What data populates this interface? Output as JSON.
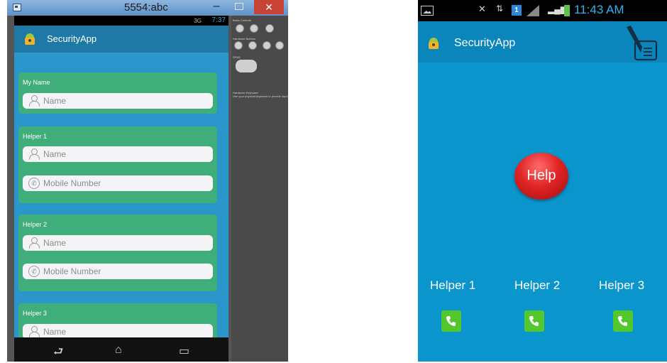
{
  "emulator": {
    "window_title": "5554:abc",
    "close_glyph": "✕",
    "minimize_glyph": "–",
    "status": {
      "signal": "3G",
      "time": "7:37"
    },
    "app_name": "SecurityApp",
    "form": [
      {
        "label": "My Name",
        "fields": [
          {
            "icon": "person-icon",
            "placeholder": "Name"
          }
        ]
      },
      {
        "label": "Helper 1",
        "fields": [
          {
            "icon": "person-icon",
            "placeholder": "Name"
          },
          {
            "icon": "phone-icon",
            "placeholder": "Mobile Number"
          }
        ]
      },
      {
        "label": "Helper 2",
        "fields": [
          {
            "icon": "person-icon",
            "placeholder": "Name"
          },
          {
            "icon": "phone-icon",
            "placeholder": "Mobile Number"
          }
        ]
      },
      {
        "label": "Helper 3",
        "fields": [
          {
            "icon": "person-icon",
            "placeholder": "Name"
          }
        ]
      }
    ],
    "nav": {
      "back": "⮐",
      "home": "⌂",
      "recents": "▭"
    },
    "side_panel": {
      "basic_controls": "Basic Controls",
      "hardware_buttons": "Hardware Buttons",
      "dpad": "DPAD",
      "hardware_keyboard": "Hardware Keyboard",
      "keyboard_hint": "Use your physical keyboard to provide input"
    }
  },
  "phone": {
    "status": {
      "time": "11:43 AM"
    },
    "app_name": "SecurityApp",
    "help_label": "Help",
    "helpers": [
      {
        "label": "Helper 1"
      },
      {
        "label": "Helper 2"
      },
      {
        "label": "Helper 3"
      }
    ]
  },
  "colors": {
    "phone_bg": "#0a96cd",
    "card_green": "#3fae7a",
    "help_red": "#e12424",
    "call_green": "#52c82c"
  }
}
